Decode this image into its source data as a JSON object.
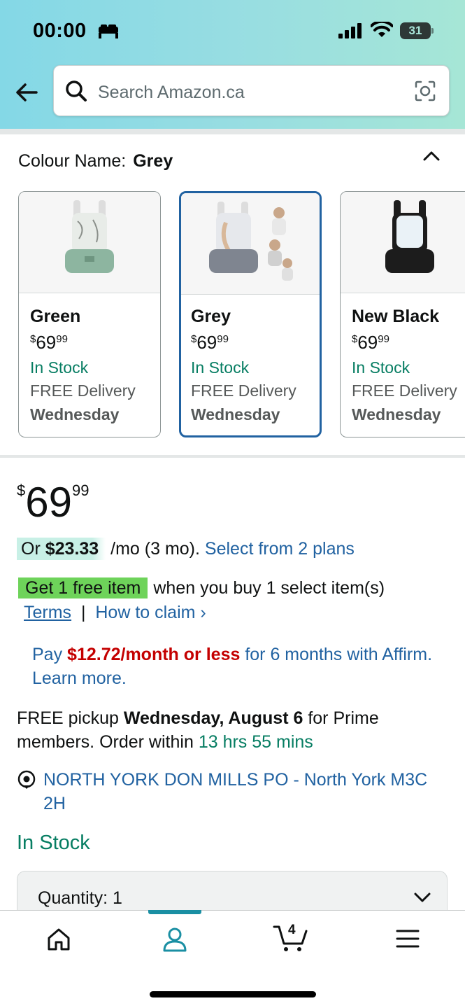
{
  "status_bar": {
    "time": "00:00",
    "battery": "31"
  },
  "search": {
    "placeholder": "Search Amazon.ca"
  },
  "colour": {
    "label": "Colour Name:",
    "selected": "Grey"
  },
  "swatches": [
    {
      "name": "Green",
      "price_dollars": "69",
      "price_cents": "99",
      "currency": "$",
      "stock": "In Stock",
      "delivery": "FREE Delivery",
      "day": "Wednesday",
      "color": "#8db5a0"
    },
    {
      "name": "Grey",
      "price_dollars": "69",
      "price_cents": "99",
      "currency": "$",
      "stock": "In Stock",
      "delivery": "FREE Delivery",
      "day": "Wednesday",
      "color": "#7f8590"
    },
    {
      "name": "New Black",
      "price_dollars": "69",
      "price_cents": "99",
      "currency": "$",
      "stock": "In Stock",
      "delivery": "FREE Delivery",
      "day": "Wednesday",
      "color": "#1c1c1c"
    }
  ],
  "price": {
    "currency": "$",
    "dollars": "69",
    "cents": "99"
  },
  "installment": {
    "prefix": "Or",
    "amount": "$23.33",
    "suffix": "/mo (3 mo).",
    "link": "Select from 2 plans"
  },
  "promo": {
    "badge": "Get 1 free item",
    "text": "when you buy 1 select item(s)",
    "terms": "Terms",
    "separator": "|",
    "how_to": "How to claim ›"
  },
  "affirm": {
    "pay": "Pay",
    "amount": "$12.72/month or less",
    "rest": "for 6 months with Affirm. Learn more."
  },
  "pickup": {
    "prefix": "FREE pickup",
    "date": "Wednesday, August 6",
    "mid": "for Prime members. Order within",
    "countdown": "13 hrs 55 mins"
  },
  "location": {
    "text": "NORTH YORK DON MILLS PO - North York M3C 2H"
  },
  "stock": {
    "text": "In Stock"
  },
  "quantity": {
    "label": "Quantity: 1"
  },
  "nav": {
    "cart_count": "4"
  },
  "colors": {
    "accent": "#1a8fa3",
    "link": "#2162a1",
    "stock": "#067d62",
    "price_red": "#c40000",
    "promo_green": "#6ed35a"
  }
}
